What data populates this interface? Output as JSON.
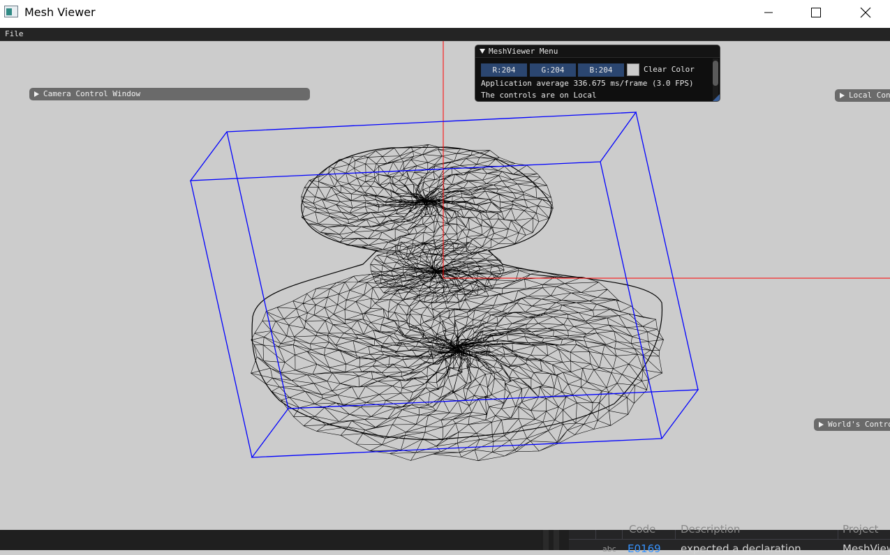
{
  "window": {
    "title": "Mesh Viewer",
    "icons": {
      "app": "app-window-icon",
      "minimize": "minimize-icon",
      "maximize": "maximize-icon",
      "close": "close-icon"
    }
  },
  "menubar": {
    "file": "File"
  },
  "camera_window": {
    "label": "Camera Control Window"
  },
  "local_window": {
    "label": "Local Controls"
  },
  "world_window": {
    "label": "World's Controls"
  },
  "menu_panel": {
    "title": "MeshViewer Menu",
    "r": "R:204",
    "g": "G:204",
    "b": "B:204",
    "clear_color_label": "Clear Color",
    "clear_color_hex": "#cccccc",
    "fps_text": "Application average 336.675 ms/frame (3.0 FPS)",
    "controls_text": "The controls are on Local"
  },
  "scene": {
    "axis_color": "#ff0000",
    "bounding_box_color": "#0000ff",
    "mesh_color": "#000000"
  },
  "error_list": {
    "headers": {
      "code": "Code",
      "description": "Description",
      "project": "Project"
    },
    "row": {
      "icon": "abc",
      "code": "E0169",
      "description": "expected a declaration",
      "project": "MeshViewer"
    }
  }
}
